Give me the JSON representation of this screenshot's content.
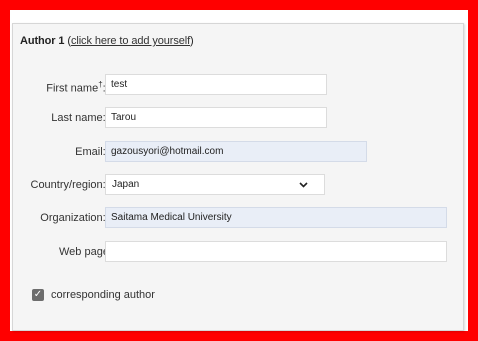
{
  "author": {
    "heading": "Author 1",
    "add_self_link": "click here to add yourself",
    "fields": {
      "first_name": {
        "label": "First name",
        "sup": "†",
        "value": "test",
        "required": true
      },
      "last_name": {
        "label": "Last name:",
        "value": "Tarou",
        "required": true
      },
      "email": {
        "label": "Email:",
        "value": "gazousyori@hotmail.com",
        "required": true
      },
      "country": {
        "label": "Country/region:",
        "value": "Japan",
        "required": true
      },
      "organization": {
        "label": "Organization:",
        "value": "Saitama Medical University",
        "required": true
      },
      "web_page": {
        "label": "Web page:",
        "value": "",
        "required": false
      }
    },
    "corresponding": {
      "label": "corresponding author",
      "checked": true
    }
  },
  "colors": {
    "frame": "#ff0000",
    "required": "#dd1111",
    "autofill": "#e9eef7"
  }
}
